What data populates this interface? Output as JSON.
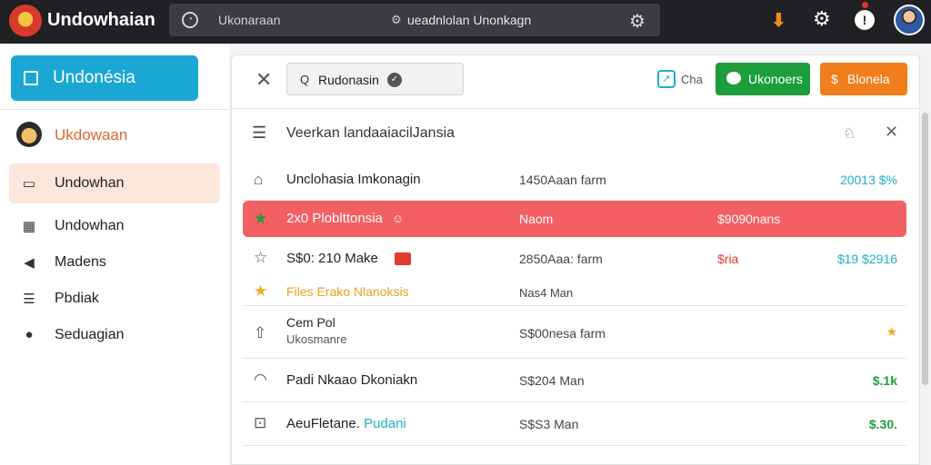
{
  "topbar": {
    "app_title": "Undowhaian",
    "search_placeholder": "Ukonaraan",
    "search_text": "ueadnlolan Unonkagn",
    "icons": [
      "clock-icon",
      "gear-icon",
      "download-arrow-icon",
      "settings-icon",
      "info-icon"
    ],
    "accent": "#f08a1c"
  },
  "sidebar": {
    "brand": "Undonésia",
    "user_label": "Ukdowaan",
    "items": [
      {
        "label": "Undowhan",
        "icon": "inbox-icon",
        "active": true
      },
      {
        "label": "Undowhan",
        "icon": "calendar-icon"
      },
      {
        "label": "Madens",
        "icon": "megaphone-icon"
      },
      {
        "label": "Pbdiak",
        "icon": "list-icon"
      },
      {
        "label": "Seduagian",
        "icon": "alert-icon"
      }
    ]
  },
  "toolbar": {
    "chip_label": "Rudonasin",
    "share_label": "Cha",
    "green_button": "Ukonoers",
    "orange_button": "Blonela",
    "colors": {
      "green": "#1e9e3a",
      "orange": "#f07e1a"
    }
  },
  "list": {
    "header": "Veerkan landaaiacilJansia",
    "rows": [
      {
        "name": "Unclohasia Imkonagin",
        "size": "1450Aaan farm",
        "price": "20013 $%",
        "price_color": "#1bb0c8"
      },
      {
        "name": "2x0 Ploblttonsia",
        "size": "Naom",
        "status": "$9090nans",
        "highlight": true
      },
      {
        "name": "S$0: 210 Make",
        "size": "2850Aaa: farm",
        "status": "$ria",
        "price": "$19 $2916",
        "price_color": "#1bb0c8"
      },
      {
        "name": "Files Erako Nlanoksis",
        "size": "Nas4 Man"
      },
      {
        "name": "Cem Pol",
        "sub": "Ukosmanre",
        "size": "S$00nesa farm",
        "price": "★"
      },
      {
        "name": "Padi Nkaao Dkoniakn",
        "size": "S$204 Man",
        "price": "$.1k",
        "price_color": "#1e9e3a"
      },
      {
        "name": "AeuFletane.",
        "name_accent": "Pudani",
        "size": "S$S3 Man",
        "price": "$.30.",
        "price_color": "#1e9e3a"
      }
    ]
  }
}
